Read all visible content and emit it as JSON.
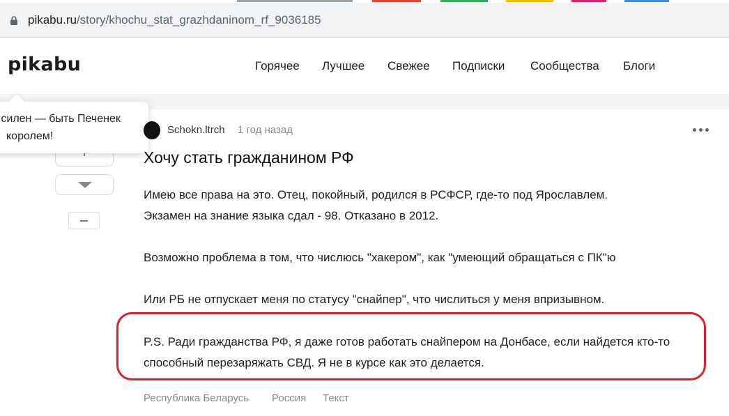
{
  "browser": {
    "url_domain": "pikabu.ru",
    "url_path": "/story/khochu_stat_grazhdaninom_rf_9036185",
    "lock_icon": "lock-icon",
    "tab_colors": [
      "#5f6368",
      "#ea4335",
      "#34a853",
      "#fbbc04",
      "#e91e63",
      "#4285f4"
    ]
  },
  "site": {
    "logo": "pikabu",
    "nav": [
      "Горячее",
      "Лучшее",
      "Свежее",
      "Подписки",
      "Сообщества",
      "Блоги"
    ]
  },
  "tooltip": {
    "line1": "й силен — быть Печенек",
    "line2": "королем!"
  },
  "story": {
    "author": "Schokn.ltrch",
    "time": "1 год назад",
    "more_icon": "more-dots-icon",
    "title": "Хочу стать гражданином РФ",
    "paragraphs": [
      "Имею все права на это. Отец, покойный, родился в РСФСР, где-то под Ярославлем.",
      "Экзамен на знание языка сдал - 98. Отказано в 2012.",
      "Возможно проблема в том, что числюсь \"хакером\", как \"умеющий обращаться с ПК\"ю",
      "Или РБ не отпускает меня по статусу \"снайпер\", что числиться у меня впризывном.",
      "P.S. Ради гражданства РФ, я даже готов работать снайпером на Донбасе, если найдется кто-то",
      "способный перезаряжать СВД. Я не в курсе как это делается."
    ],
    "tags": [
      "Республика Беларусь",
      "Россия",
      "Текст"
    ],
    "highlight_color": "#d9202b"
  }
}
